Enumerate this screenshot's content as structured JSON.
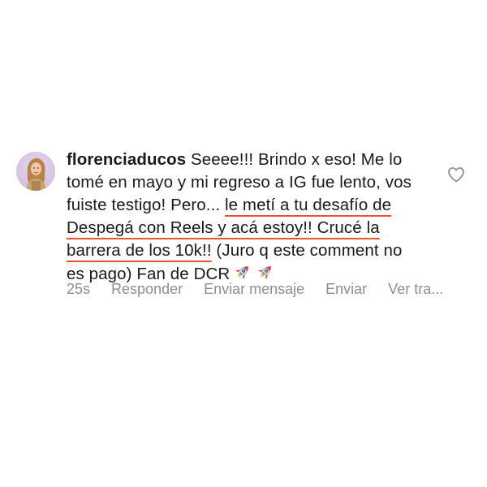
{
  "comment": {
    "username": "florenciaducos",
    "text_plain": "Seeee!!! Brindo x eso! Me lo tomé en mayo y mi regreso a IG fue lento, vos fuiste testigo! Pero...",
    "text_highlight": "le metí a tu desafío de Despegá con Reels y acá estoy!! Crucé la barrera de los 10k!!",
    "text_tail": "(Juro q este comment no es pago) Fan de DCR",
    "emojis": [
      "rocket-icon",
      "rocket-icon"
    ],
    "highlight_color": "#e8542c"
  },
  "actions": {
    "time": "25s",
    "reply": "Responder",
    "send_message": "Enviar mensaje",
    "send": "Enviar",
    "see_translation": "Ver tra..."
  },
  "icons": {
    "like": "heart-outline-icon"
  }
}
